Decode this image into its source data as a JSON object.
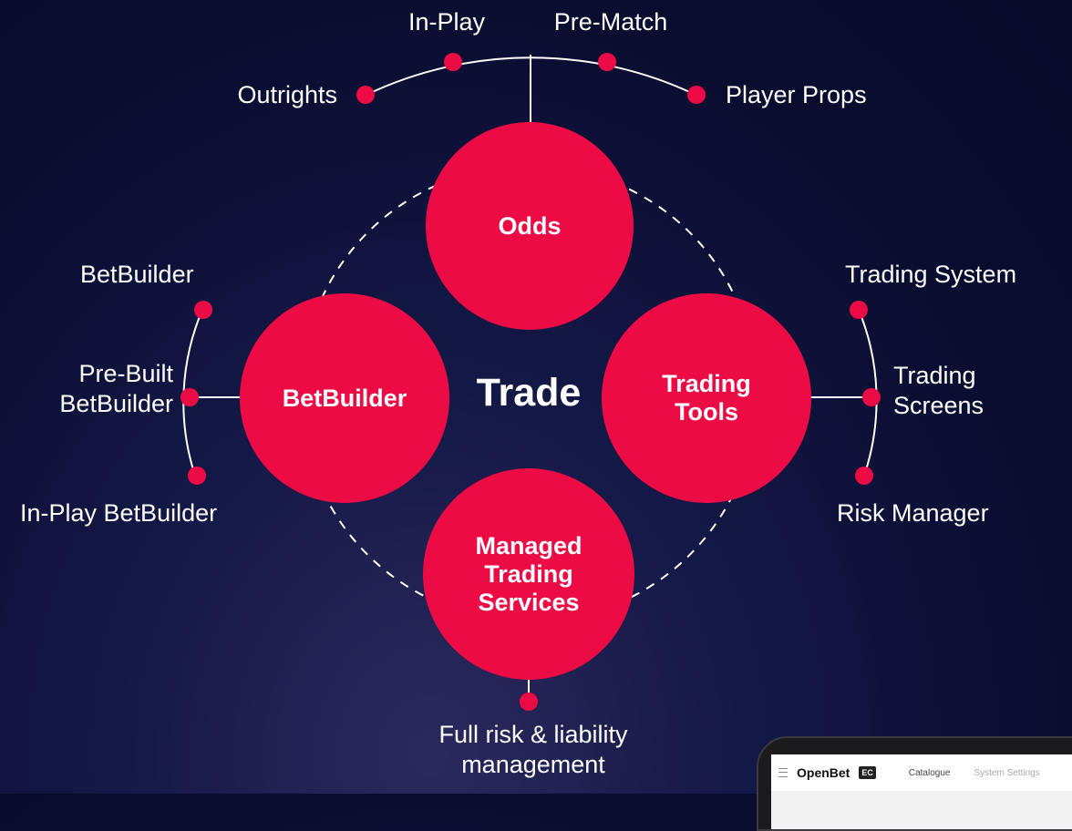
{
  "colors": {
    "accent": "#ec0b45",
    "background": "#090d30",
    "text": "#ffffff"
  },
  "center_label": "Trade",
  "hubs": {
    "top": "Odds",
    "left": "BetBuilder",
    "right": "Trading\nTools",
    "bottom": "Managed\nTrading\nServices"
  },
  "branches": {
    "odds": [
      "Outrights",
      "In-Play",
      "Pre-Match",
      "Player Props"
    ],
    "betbuilder": [
      "BetBuilder",
      "Pre-Built\nBetBuilder",
      "In-Play BetBuilder"
    ],
    "trading_tools": [
      "Trading System",
      "Trading\nScreens",
      "Risk Manager"
    ],
    "managed": [
      "Full risk & liability\nmanagement"
    ]
  },
  "laptop": {
    "brand": "OpenBet",
    "badge": "EC",
    "nav": [
      "Catalogue",
      "System Settings"
    ]
  }
}
